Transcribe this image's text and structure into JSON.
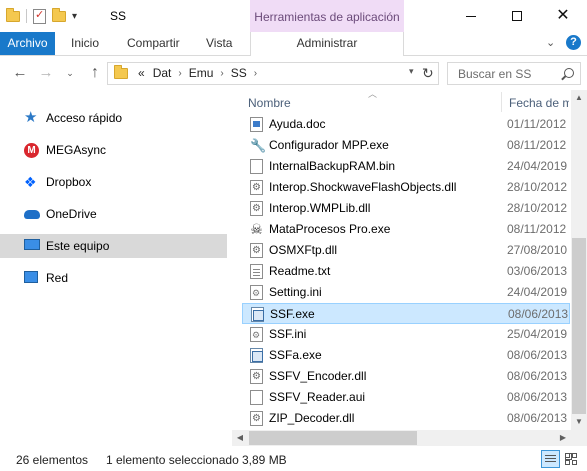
{
  "window": {
    "title": "SS",
    "context_header": "Herramientas de aplicación",
    "controls": {
      "minimize": "minimize-icon",
      "maximize": "maximize-icon",
      "close": "close-icon"
    }
  },
  "ribbon": {
    "tabs": [
      "Archivo",
      "Inicio",
      "Compartir",
      "Vista",
      "Administrar"
    ],
    "active_tab": "Archivo",
    "accent": "#1979ca",
    "context_color": "#f0dcf6"
  },
  "address": {
    "prefix": "«",
    "crumbs": [
      "Dat",
      "Emu",
      "SS"
    ],
    "separator": "›"
  },
  "search": {
    "placeholder": "Buscar en SS"
  },
  "nav": {
    "items": [
      {
        "label": "Acceso rápido",
        "icon": "star-icon"
      },
      {
        "label": "MEGAsync",
        "icon": "mega-icon"
      },
      {
        "label": "Dropbox",
        "icon": "dropbox-icon"
      },
      {
        "label": "OneDrive",
        "icon": "onedrive-icon"
      },
      {
        "label": "Este equipo",
        "icon": "computer-icon",
        "selected": true
      },
      {
        "label": "Red",
        "icon": "network-icon"
      }
    ]
  },
  "filelist": {
    "columns": {
      "name": "Nombre",
      "date": "Fecha de m"
    },
    "files": [
      {
        "name": "Ayuda.doc",
        "date": "01/11/2012",
        "icon": "doc"
      },
      {
        "name": "Configurador MPP.exe",
        "date": "08/11/2012",
        "icon": "wrench"
      },
      {
        "name": "InternalBackupRAM.bin",
        "date": "24/04/2019",
        "icon": "blank"
      },
      {
        "name": "Interop.ShockwaveFlashObjects.dll",
        "date": "28/10/2012",
        "icon": "gear"
      },
      {
        "name": "Interop.WMPLib.dll",
        "date": "28/10/2012",
        "icon": "gear"
      },
      {
        "name": "MataProcesos Pro.exe",
        "date": "08/11/2012",
        "icon": "skull"
      },
      {
        "name": "OSMXFtp.dll",
        "date": "27/08/2010",
        "icon": "gear"
      },
      {
        "name": "Readme.txt",
        "date": "03/06/2013",
        "icon": "txt"
      },
      {
        "name": "Setting.ini",
        "date": "24/04/2019",
        "icon": "ini"
      },
      {
        "name": "SSF.exe",
        "date": "08/06/2013",
        "icon": "exe",
        "selected": true
      },
      {
        "name": "SSF.ini",
        "date": "25/04/2019",
        "icon": "ini"
      },
      {
        "name": "SSFa.exe",
        "date": "08/06/2013",
        "icon": "exe"
      },
      {
        "name": "SSFV_Encoder.dll",
        "date": "08/06/2013",
        "icon": "gear"
      },
      {
        "name": "SSFV_Reader.aui",
        "date": "08/06/2013",
        "icon": "blank"
      },
      {
        "name": "ZIP_Decoder.dll",
        "date": "08/06/2013",
        "icon": "gear"
      }
    ]
  },
  "status": {
    "count": "26 elementos",
    "selection": "1 elemento seleccionado",
    "size": "3,89 MB"
  }
}
